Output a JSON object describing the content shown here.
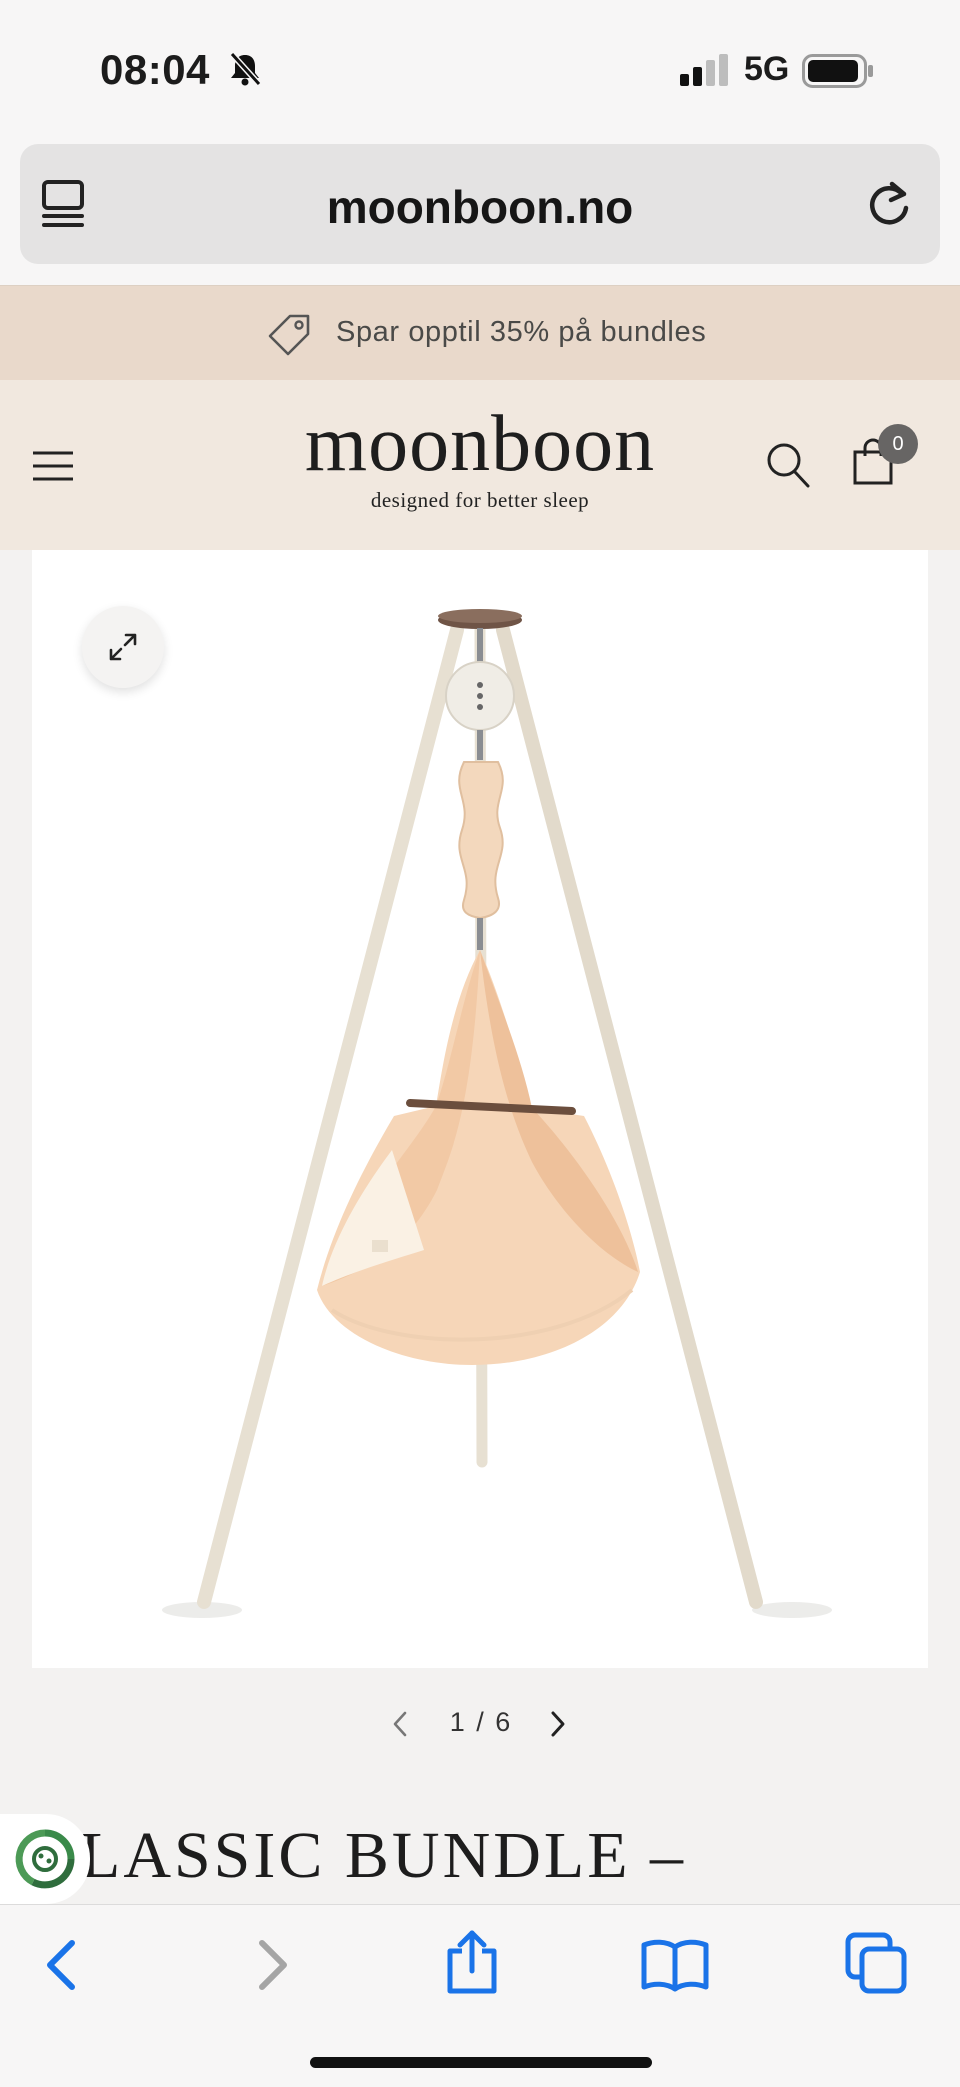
{
  "status_bar": {
    "time": "08:04",
    "network": "5G"
  },
  "browser": {
    "url": "moonboon.no"
  },
  "promo": {
    "text": "Spar opptil 35% på bundles"
  },
  "header": {
    "logo": "moonboon",
    "tagline": "designed for better sleep",
    "cart_count": "0"
  },
  "gallery": {
    "counter": "1 / 6"
  },
  "product": {
    "title": "LASSIC BUNDLE –"
  },
  "colors": {
    "promo_bg": "#e9d9cb",
    "header_bg": "#f1e8df",
    "safari_blue": "#1a73e8"
  }
}
